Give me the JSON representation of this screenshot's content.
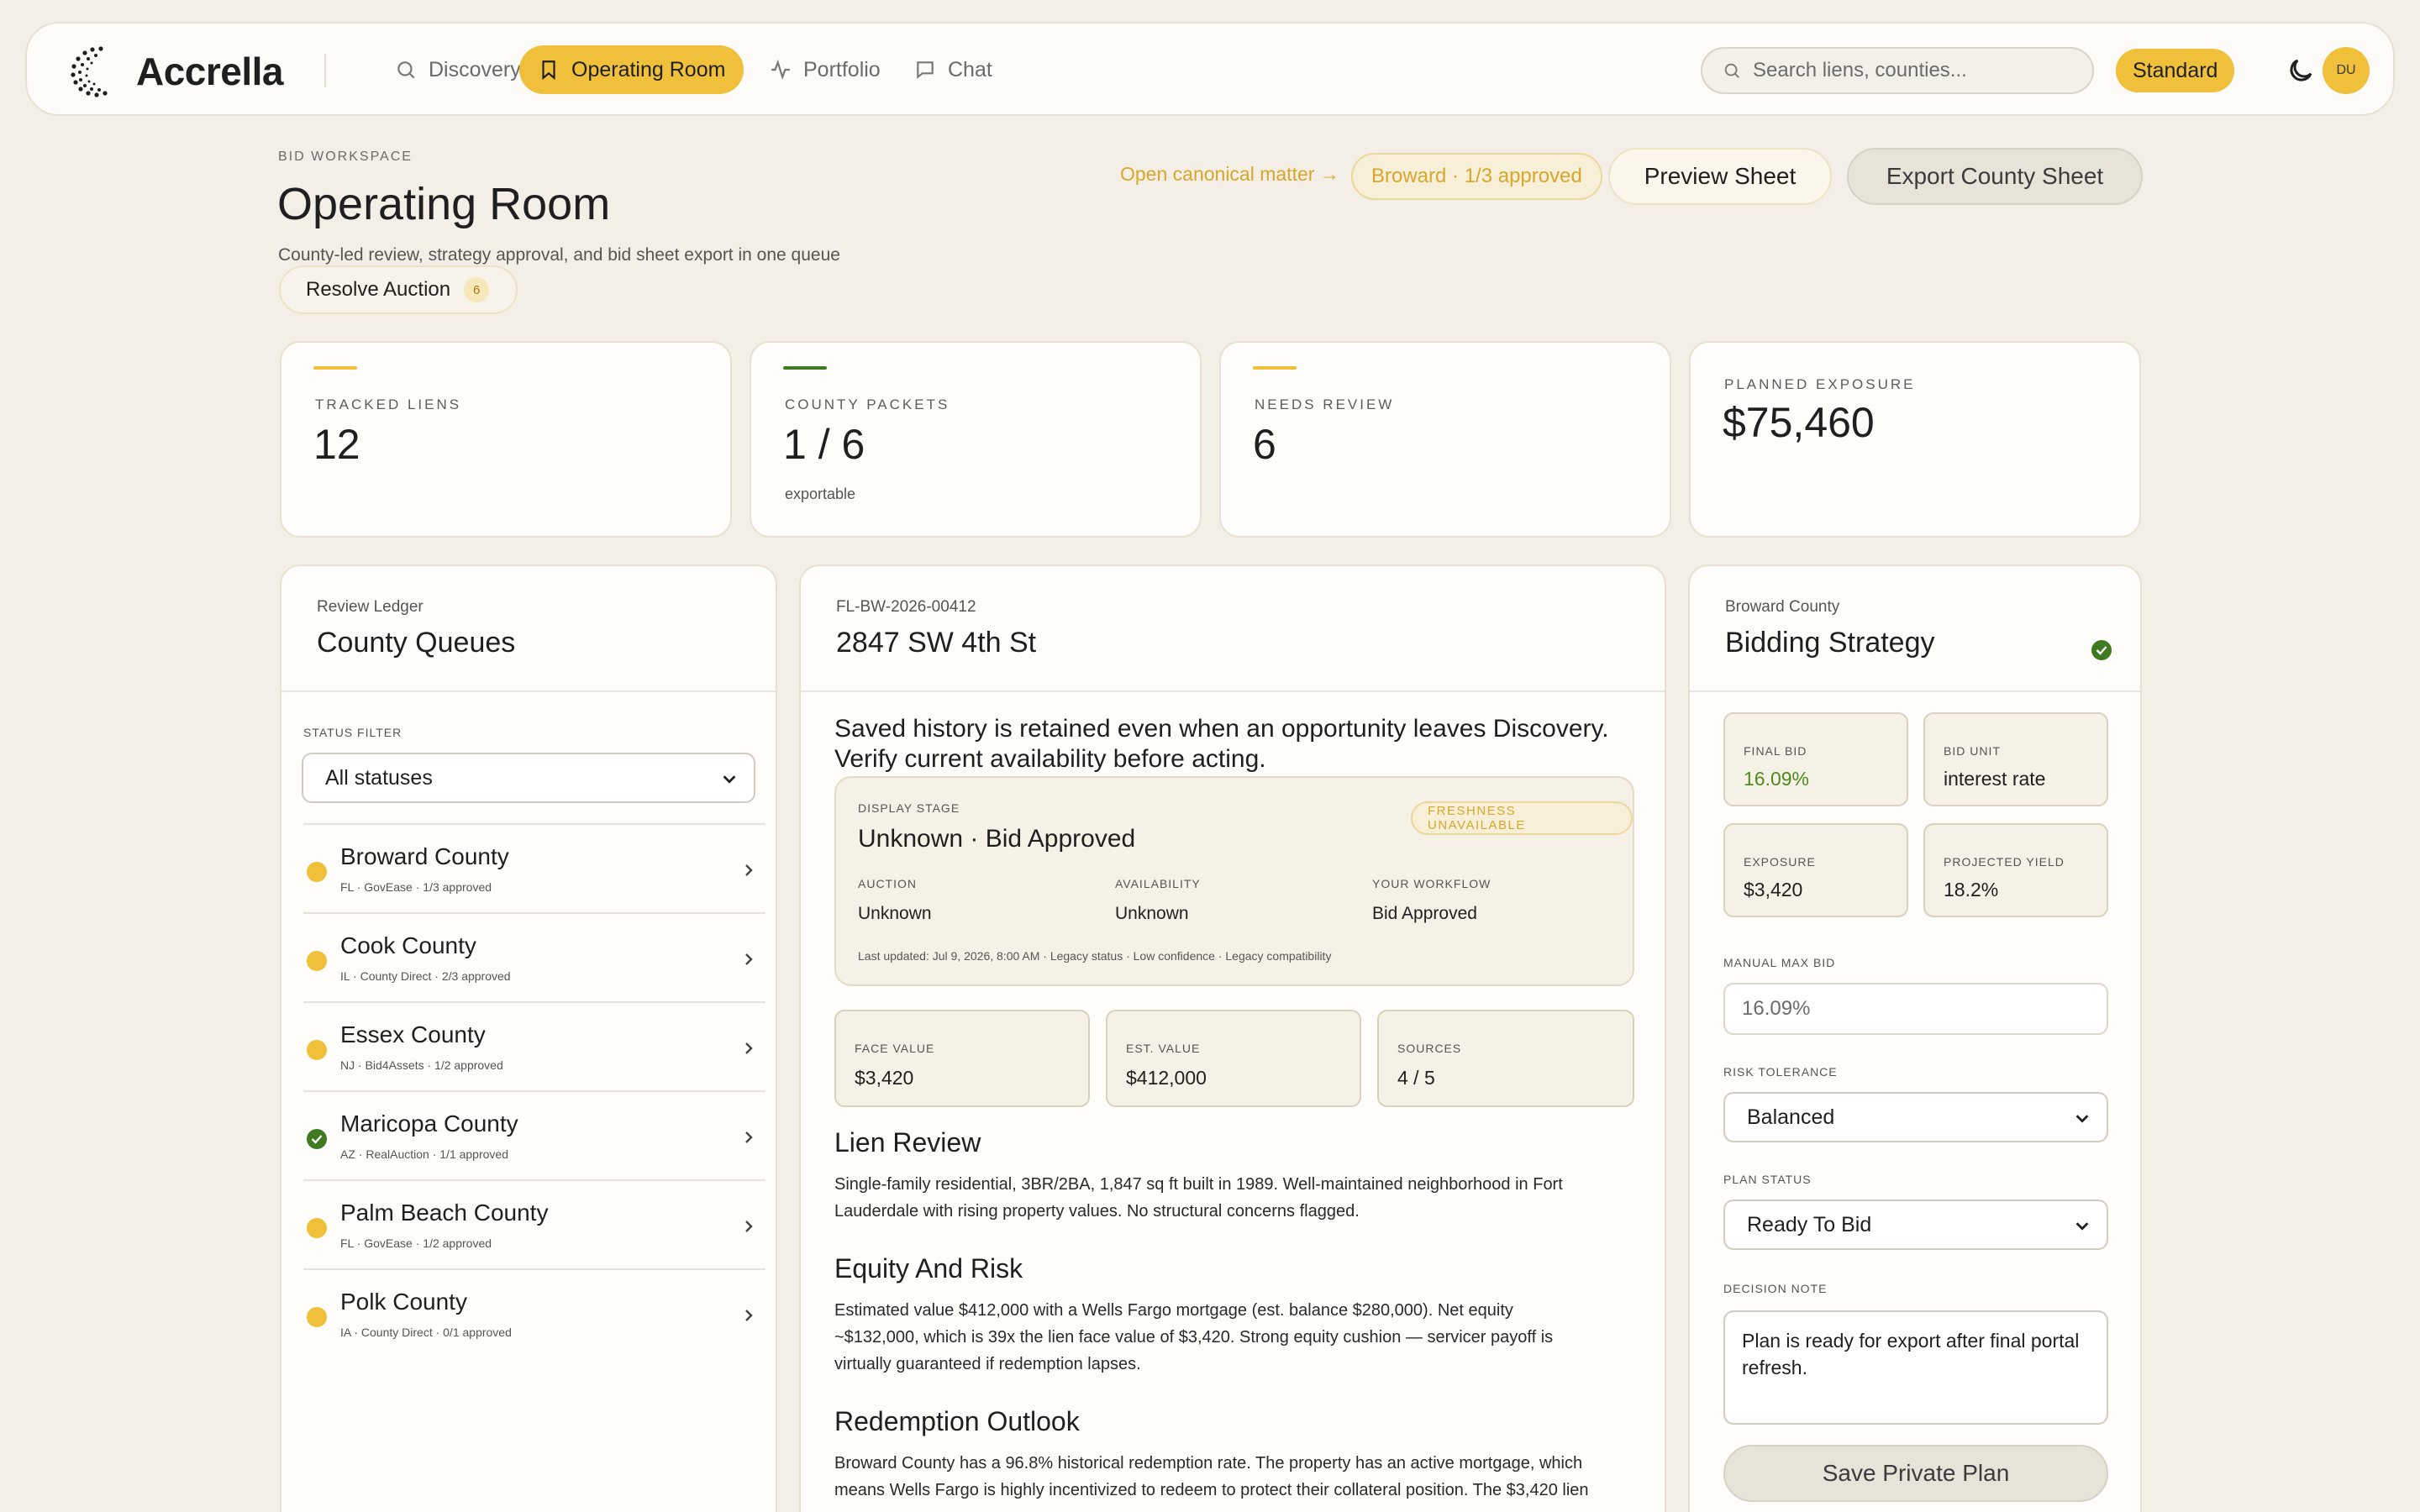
{
  "brand": {
    "name": "Accrella"
  },
  "nav": [
    {
      "label": "Discovery",
      "icon": "search-icon"
    },
    {
      "label": "Operating Room",
      "icon": "bookmark-icon",
      "active": true
    },
    {
      "label": "Portfolio",
      "icon": "activity-icon"
    },
    {
      "label": "Chat",
      "icon": "chat-icon"
    }
  ],
  "search": {
    "placeholder": "Search liens, counties..."
  },
  "plan": "Standard",
  "user": {
    "initials": "DU"
  },
  "header": {
    "eyebrow": "BID WORKSPACE",
    "title": "Operating Room",
    "subtitle": "County-led review, strategy approval, and bid sheet export in one queue",
    "resolve_label": "Resolve Auction",
    "resolve_count": "6",
    "canonical_link": "Open canonical matter →",
    "status_pill": "Broward · 1/3 approved",
    "preview_button": "Preview Sheet",
    "export_button": "Export County Sheet"
  },
  "stats": [
    {
      "label": "TRACKED LIENS",
      "value": "12",
      "note": "",
      "accent": "#f0c03a"
    },
    {
      "label": "COUNTY PACKETS",
      "value": "1 / 6",
      "note": "exportable",
      "accent": "#3d7a20"
    },
    {
      "label": "NEEDS REVIEW",
      "value": "6",
      "note": "",
      "accent": "#f0c03a"
    },
    {
      "label": "PLANNED EXPOSURE",
      "value": "$75,460",
      "note": ""
    }
  ],
  "ledger": {
    "eyebrow": "Review Ledger",
    "title": "County Queues",
    "filter_label": "STATUS FILTER",
    "filter_value": "All statuses",
    "counties": [
      {
        "name": "Broward County",
        "meta": "FL · GovEase · 1/3 approved",
        "status": "pending"
      },
      {
        "name": "Cook County",
        "meta": "IL · County Direct · 2/3 approved",
        "status": "pending"
      },
      {
        "name": "Essex County",
        "meta": "NJ · Bid4Assets · 1/2 approved",
        "status": "pending"
      },
      {
        "name": "Maricopa County",
        "meta": "AZ · RealAuction · 1/1 approved",
        "status": "complete"
      },
      {
        "name": "Palm Beach County",
        "meta": "FL · GovEase · 1/2 approved",
        "status": "pending"
      },
      {
        "name": "Polk County",
        "meta": "IA · County Direct · 0/1 approved",
        "status": "pending"
      }
    ]
  },
  "detail": {
    "id": "FL-BW-2026-00412",
    "address": "2847 SW 4th St",
    "alert": "Saved history is retained even when an opportunity leaves Discovery. Verify current availability before acting.",
    "stage_label": "DISPLAY STAGE",
    "stage_value": "Unknown · Bid Approved",
    "freshness": "FRESHNESS UNAVAILABLE",
    "auction_label": "AUCTION",
    "auction_value": "Unknown",
    "availability_label": "AVAILABILITY",
    "availability_value": "Unknown",
    "workflow_label": "YOUR WORKFLOW",
    "workflow_value": "Bid Approved",
    "last_updated": "Last updated: Jul 9, 2026, 8:00 AM · Legacy status · Low confidence · Legacy compatibility",
    "metrics": [
      {
        "label": "FACE VALUE",
        "value": "$3,420"
      },
      {
        "label": "EST. VALUE",
        "value": "$412,000"
      },
      {
        "label": "SOURCES",
        "value": "4 / 5"
      }
    ],
    "sections": [
      {
        "title": "Lien Review",
        "body": "Single-family residential, 3BR/2BA, 1,847 sq ft built in 1989. Well-maintained neighborhood in Fort Lauderdale with rising property values. No structural concerns flagged."
      },
      {
        "title": "Equity And Risk",
        "body": "Estimated value $412,000 with a Wells Fargo mortgage (est. balance $280,000). Net equity ~$132,000, which is 39x the lien face value of $3,420. Strong equity cushion — servicer payoff is virtually guaranteed if redemption lapses."
      },
      {
        "title": "Redemption Outlook",
        "body": "Broward County has a 96.8% historical redemption rate. The property has an active mortgage, which means Wells Fargo is highly incentivized to redeem to protect their collateral position. The $3,420 lien"
      }
    ]
  },
  "strategy": {
    "eyebrow": "Broward County",
    "title": "Bidding Strategy",
    "final_bid_label": "FINAL BID",
    "final_bid_value": "16.09%",
    "bid_unit_label": "BID UNIT",
    "bid_unit_value": "interest rate",
    "exposure_label": "EXPOSURE",
    "exposure_value": "$3,420",
    "yield_label": "PROJECTED YIELD",
    "yield_value": "18.2%",
    "manual_max_label": "MANUAL MAX BID",
    "manual_max_placeholder": "16.09%",
    "risk_label": "RISK TOLERANCE",
    "risk_value": "Balanced",
    "plan_status_label": "PLAN STATUS",
    "plan_status_value": "Ready To Bid",
    "note_label": "DECISION NOTE",
    "note_value": "Plan is ready for export after final portal refresh.",
    "save_button": "Save Private Plan"
  },
  "colors": {
    "accent": "#f0c03a",
    "success": "#3d7a20",
    "background": "#f3efe6"
  }
}
